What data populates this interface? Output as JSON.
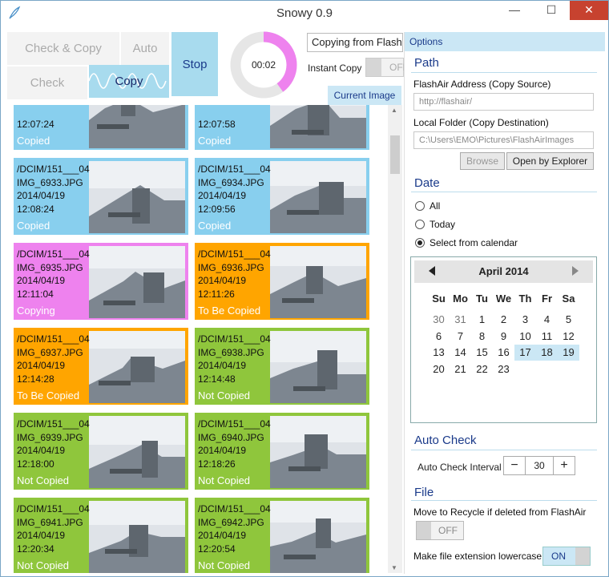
{
  "window": {
    "title": "Snowy 0.9",
    "min_glyph": "—",
    "max_glyph": "☐",
    "close_glyph": "✕"
  },
  "toolbar": {
    "check_copy_label": "Check & Copy",
    "auto_label": "Auto",
    "check_label": "Check",
    "copy_label": "Copy",
    "stop_label": "Stop",
    "timer": "00:02",
    "timer_progress": 0.4,
    "status_text": "Copying from FlashAir",
    "instant_copy_label": "Instant Copy",
    "instant_copy_state": "OFF",
    "current_image_label": "Current Image"
  },
  "colors": {
    "copied": "#88cfee",
    "copying": "#ee82ee",
    "to_be_copied": "#ffa500",
    "not_copied": "#8fc63c",
    "accent": "#cbe7f5"
  },
  "images": [
    {
      "dir": "",
      "file": "",
      "date": "",
      "time": "12:07:24",
      "status": "Copied",
      "state": "copied"
    },
    {
      "dir": "",
      "file": "",
      "date": "",
      "time": "12:07:58",
      "status": "Copied",
      "state": "copied"
    },
    {
      "dir": "/DCIM/151___04",
      "file": "IMG_6933.JPG",
      "date": "2014/04/19",
      "time": "12:08:24",
      "status": "Copied",
      "state": "copied"
    },
    {
      "dir": "/DCIM/151___04",
      "file": "IMG_6934.JPG",
      "date": "2014/04/19",
      "time": "12:09:56",
      "status": "Copied",
      "state": "copied"
    },
    {
      "dir": "/DCIM/151___04",
      "file": "IMG_6935.JPG",
      "date": "2014/04/19",
      "time": "12:11:04",
      "status": "Copying",
      "state": "copying"
    },
    {
      "dir": "/DCIM/151___04",
      "file": "IMG_6936.JPG",
      "date": "2014/04/19",
      "time": "12:11:26",
      "status": "To Be Copied",
      "state": "to_be_copied"
    },
    {
      "dir": "/DCIM/151___04",
      "file": "IMG_6937.JPG",
      "date": "2014/04/19",
      "time": "12:14:28",
      "status": "To Be Copied",
      "state": "to_be_copied"
    },
    {
      "dir": "/DCIM/151___04",
      "file": "IMG_6938.JPG",
      "date": "2014/04/19",
      "time": "12:14:48",
      "status": "Not Copied",
      "state": "not_copied"
    },
    {
      "dir": "/DCIM/151___04",
      "file": "IMG_6939.JPG",
      "date": "2014/04/19",
      "time": "12:18:00",
      "status": "Not Copied",
      "state": "not_copied"
    },
    {
      "dir": "/DCIM/151___04",
      "file": "IMG_6940.JPG",
      "date": "2014/04/19",
      "time": "12:18:26",
      "status": "Not Copied",
      "state": "not_copied"
    },
    {
      "dir": "/DCIM/151___04",
      "file": "IMG_6941.JPG",
      "date": "2014/04/19",
      "time": "12:20:34",
      "status": "Not Copied",
      "state": "not_copied"
    },
    {
      "dir": "/DCIM/151___04",
      "file": "IMG_6942.JPG",
      "date": "2014/04/19",
      "time": "12:20:54",
      "status": "Not Copied",
      "state": "not_copied"
    }
  ],
  "options": {
    "header": "Options",
    "path": {
      "title": "Path",
      "address_label": "FlashAir Address (Copy Source)",
      "address_value": "http://flashair/",
      "folder_label": "Local Folder (Copy Destination)",
      "folder_value": "C:\\Users\\EMO\\Pictures\\FlashAirImages",
      "browse_label": "Browse",
      "explorer_label": "Open by Explorer"
    },
    "date": {
      "title": "Date",
      "options": [
        "All",
        "Today",
        "Select from calendar"
      ],
      "selected": 2,
      "calendar": {
        "month_label": "April 2014",
        "weekdays": [
          "Su",
          "Mo",
          "Tu",
          "We",
          "Th",
          "Fr",
          "Sa"
        ],
        "weeks": [
          [
            "30",
            "31",
            "1",
            "2",
            "3",
            "4",
            "5"
          ],
          [
            "6",
            "7",
            "8",
            "9",
            "10",
            "11",
            "12"
          ],
          [
            "13",
            "14",
            "15",
            "16",
            "17",
            "18",
            "19"
          ],
          [
            "20",
            "21",
            "22",
            "23",
            "",
            "",
            ""
          ]
        ],
        "other_month": [
          "30",
          "31"
        ],
        "selected_days": [
          "17",
          "18",
          "19"
        ]
      }
    },
    "auto_check": {
      "title": "Auto Check",
      "interval_label": "Auto Check Interval",
      "interval_value": "30",
      "minus": "−",
      "plus": "+"
    },
    "file": {
      "title": "File",
      "recycle_label": "Move to Recycle if deleted from FlashAir",
      "recycle_state": "OFF",
      "lowercase_label": "Make file extension lowercase",
      "lowercase_state": "ON"
    }
  }
}
